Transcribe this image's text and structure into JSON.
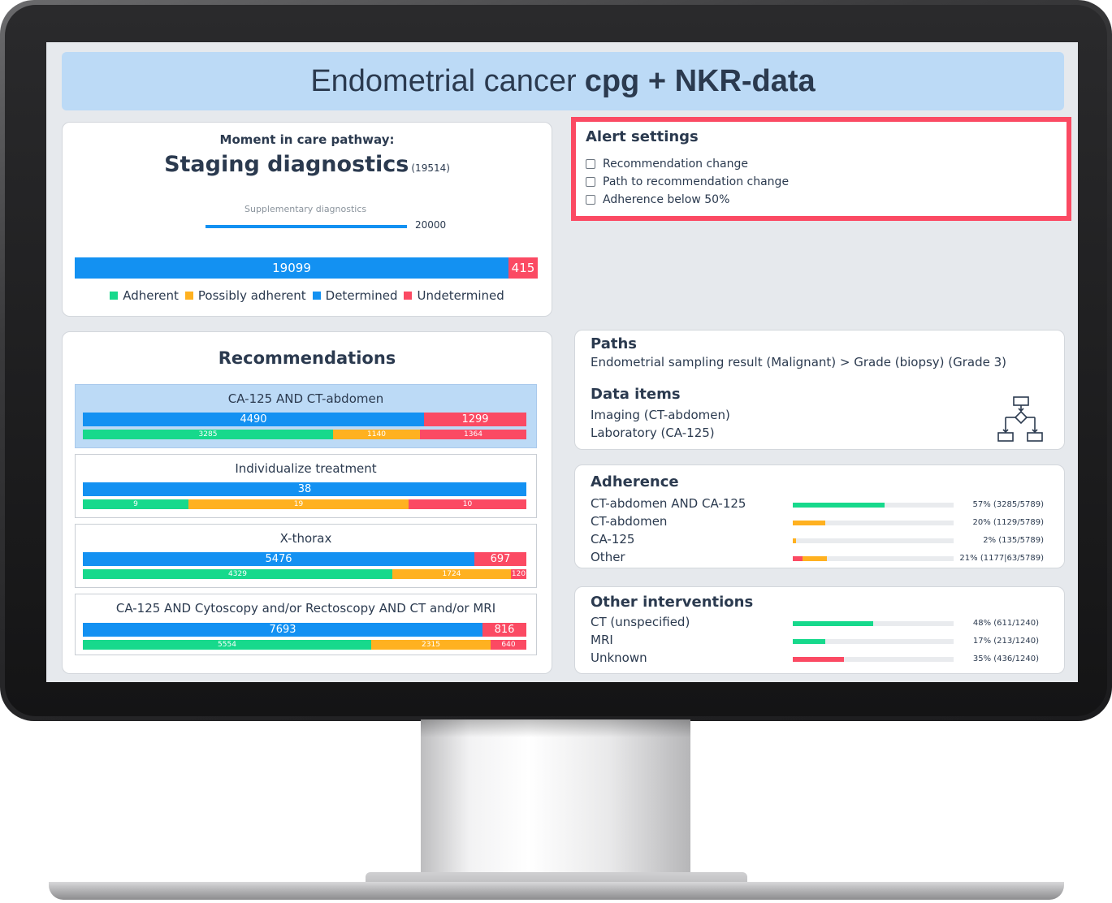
{
  "title": {
    "prefix": "Endometrial cancer",
    "bold": "cpg + NKR-data"
  },
  "moment": {
    "label": "Moment in care pathway:",
    "stage": "Staging diagnostics",
    "count": "(19514)",
    "supplementary_label": "Supplementary diagnostics",
    "supplementary_value": "20000",
    "bar": {
      "determined": "19099",
      "undetermined": "415"
    },
    "legend": [
      {
        "label": "Adherent",
        "color": "#17d98c"
      },
      {
        "label": "Possibly adherent",
        "color": "#ffb120"
      },
      {
        "label": "Determined",
        "color": "#1391f2"
      },
      {
        "label": "Undetermined",
        "color": "#fb4a63"
      }
    ]
  },
  "alert": {
    "title": "Alert settings",
    "options": [
      "Recommendation change",
      "Path to recommendation change",
      "Adherence below 50%"
    ]
  },
  "recommendations": {
    "title": "Recommendations",
    "items": [
      {
        "title": "CA-125    AND    CT-abdomen",
        "determined": "4490",
        "undetermined": "1299",
        "adherent": "3285",
        "possibly": "1140",
        "nonadherent": "1364"
      },
      {
        "title": "Individualize treatment",
        "determined": "38",
        "undetermined": "",
        "adherent": "9",
        "possibly": "19",
        "nonadherent": "10"
      },
      {
        "title": "X-thorax",
        "determined": "5476",
        "undetermined": "697",
        "adherent": "4329",
        "possibly": "1724",
        "nonadherent": "120"
      },
      {
        "title": "CA-125    AND    Cytoscopy and/or Rectoscopy    AND    CT and/or MRI",
        "determined": "7693",
        "undetermined": "816",
        "adherent": "5554",
        "possibly": "2315",
        "nonadherent": "640"
      }
    ]
  },
  "paths": {
    "title": "Paths",
    "path": "Endometrial sampling result (Malignant) >  Grade (biopsy) (Grade 3)",
    "data_items_title": "Data items",
    "data_items": [
      "Imaging (CT-abdomen)",
      "Laboratory (CA-125)"
    ],
    "icon": "flowchart-icon"
  },
  "adherence": {
    "title": "Adherence",
    "rows": [
      {
        "name": "CT-abdomen AND CA-125",
        "pct": "57% (3285/5789)",
        "fill": 0.57,
        "color": "#17d98c"
      },
      {
        "name": "CT-abdomen",
        "pct": "20% (1129/5789)",
        "fill": 0.2,
        "color": "#ffb120"
      },
      {
        "name": "CA-125",
        "pct": "2% (135/5789)",
        "fill": 0.02,
        "color": "#ffb120"
      },
      {
        "name": "Other",
        "pct": "21% (1177|63/5789)",
        "fill_red": 0.06,
        "fill": 0.15,
        "color": "#ffb120"
      }
    ]
  },
  "other_interventions": {
    "title": "Other interventions",
    "rows": [
      {
        "name": "CT (unspecified)",
        "pct": "48% (611/1240)",
        "fill": 0.5,
        "color": "#17d98c"
      },
      {
        "name": "MRI",
        "pct": "17% (213/1240)",
        "fill": 0.2,
        "color": "#17d98c"
      },
      {
        "name": "Unknown",
        "pct": "35% (436/1240)",
        "fill": 0.32,
        "color": "#fb4a63"
      }
    ]
  }
}
